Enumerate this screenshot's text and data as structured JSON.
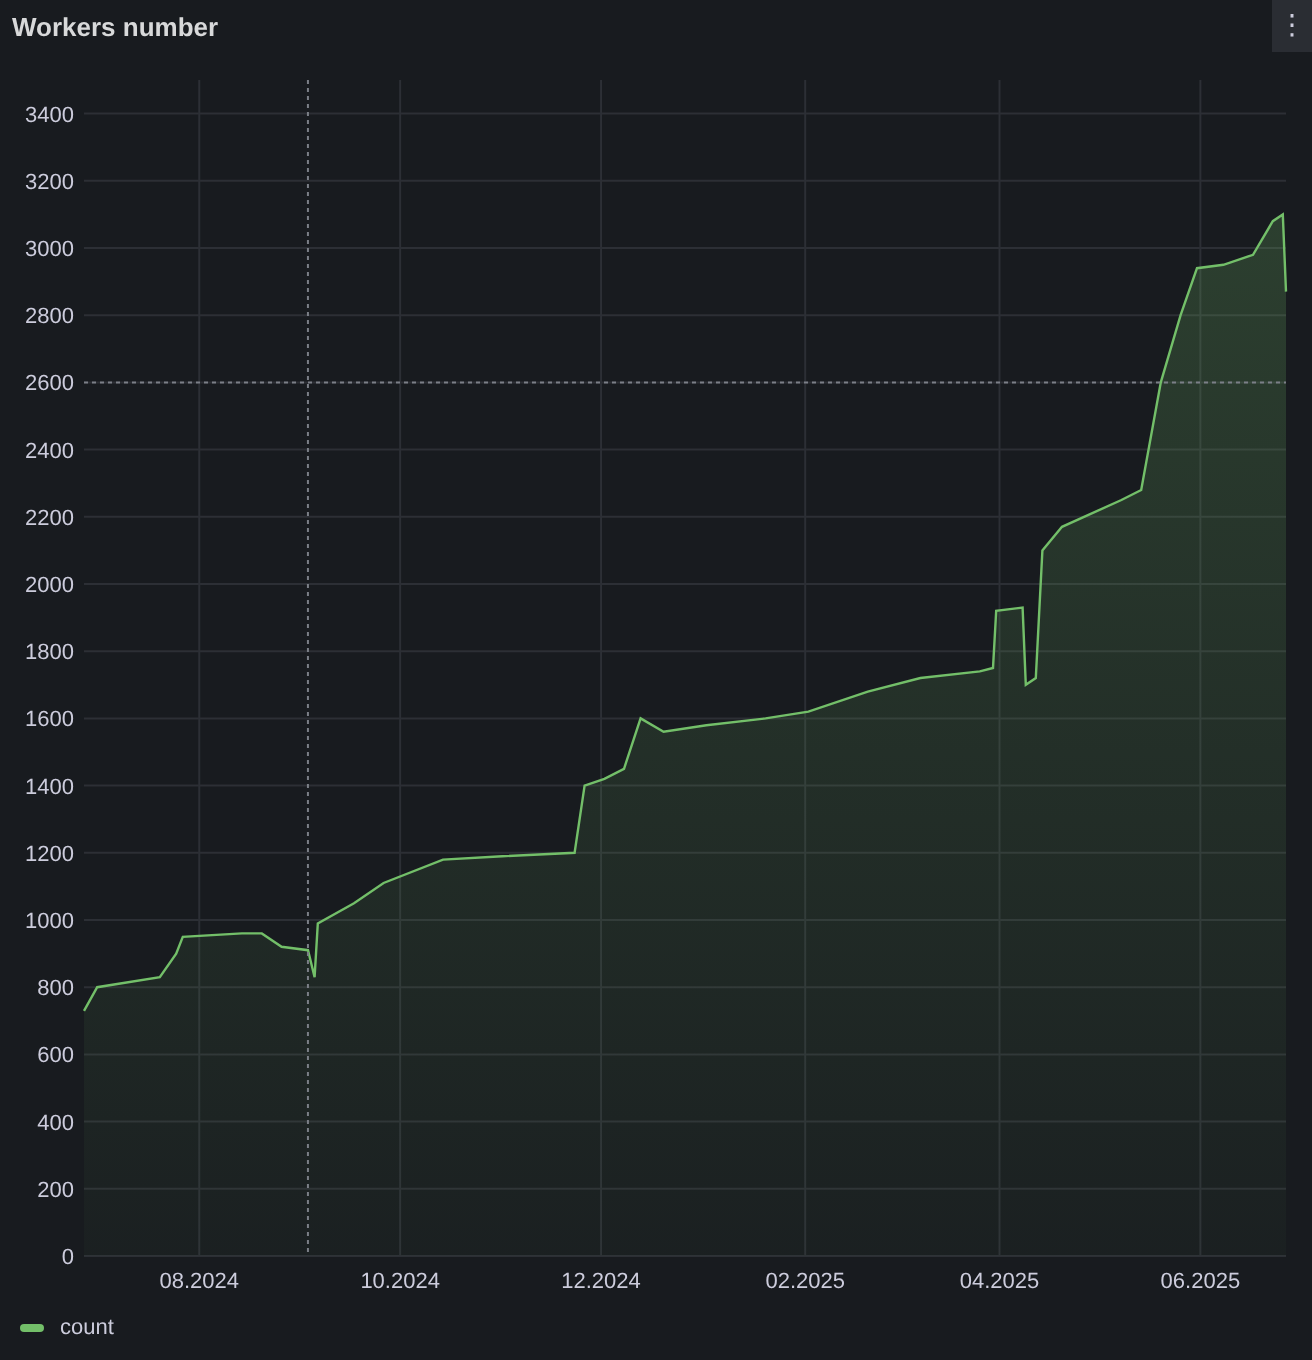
{
  "panel": {
    "title": "Workers number",
    "menu_icon": "⋮",
    "chart_data": {
      "type": "area",
      "xlim": [
        "2024-06-27",
        "2025-06-27"
      ],
      "ylim": [
        0,
        3500
      ],
      "yticks": [
        0,
        200,
        400,
        600,
        800,
        1000,
        1200,
        1400,
        1600,
        1800,
        2000,
        2200,
        2400,
        2600,
        2800,
        3000,
        3200,
        3400
      ],
      "xticks": [
        {
          "value": "2024-08-01",
          "label": "08.2024"
        },
        {
          "value": "2024-10-01",
          "label": "10.2024"
        },
        {
          "value": "2024-12-01",
          "label": "12.2024"
        },
        {
          "value": "2025-02-01",
          "label": "02.2025"
        },
        {
          "value": "2025-04-01",
          "label": "04.2025"
        },
        {
          "value": "2025-06-01",
          "label": "06.2025"
        }
      ],
      "x": [
        "2024-06-27",
        "2024-07-01",
        "2024-07-20",
        "2024-07-25",
        "2024-07-27",
        "2024-08-14",
        "2024-08-20",
        "2024-08-26",
        "2024-09-03",
        "2024-09-05",
        "2024-09-06",
        "2024-09-17",
        "2024-09-26",
        "2024-10-14",
        "2024-11-01",
        "2024-11-23",
        "2024-11-26",
        "2024-12-02",
        "2024-12-08",
        "2024-12-13",
        "2024-12-20",
        "2025-01-02",
        "2025-01-20",
        "2025-02-02",
        "2025-02-20",
        "2025-03-08",
        "2025-03-26",
        "2025-03-30",
        "2025-03-31",
        "2025-04-08",
        "2025-04-09",
        "2025-04-12",
        "2025-04-14",
        "2025-04-20",
        "2025-05-08",
        "2025-05-14",
        "2025-05-20",
        "2025-05-26",
        "2025-05-31",
        "2025-06-08",
        "2025-06-17",
        "2025-06-23",
        "2025-06-26",
        "2025-06-27"
      ],
      "series": [
        {
          "name": "count",
          "color": "#73bf69",
          "values": [
            730,
            800,
            830,
            900,
            950,
            960,
            960,
            920,
            910,
            830,
            990,
            1050,
            1110,
            1180,
            1190,
            1200,
            1400,
            1420,
            1450,
            1600,
            1560,
            1580,
            1600,
            1620,
            1680,
            1720,
            1740,
            1750,
            1920,
            1930,
            1700,
            1720,
            2100,
            2170,
            2250,
            2280,
            2600,
            2800,
            2940,
            2950,
            2980,
            3080,
            3100,
            2870
          ]
        }
      ],
      "grid": true,
      "ref_lines": [
        {
          "axis": "x",
          "value": "2024-09-03"
        },
        {
          "axis": "y",
          "value": 2600
        }
      ]
    }
  }
}
